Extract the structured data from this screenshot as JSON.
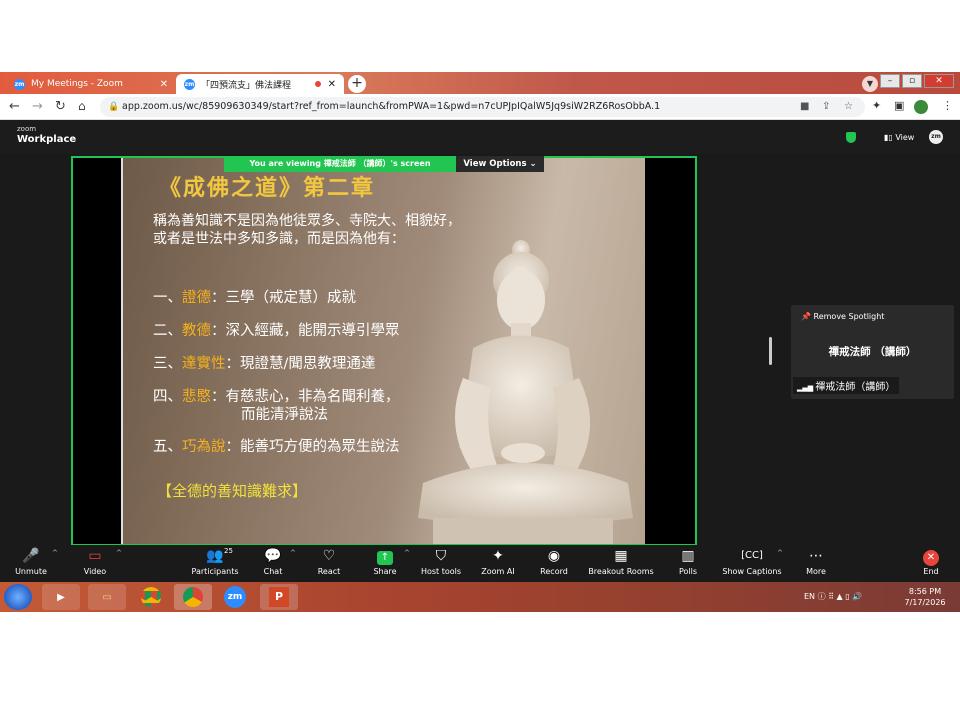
{
  "browser": {
    "tabs": [
      {
        "label": "My Meetings - Zoom",
        "favicon": "zm"
      },
      {
        "label": "「四預流支」佛法課程",
        "favicon": "zm"
      }
    ],
    "new_tab_glyph": "+",
    "window_min": "–",
    "window_max": "▫",
    "window_close": "✕",
    "url": "app.zoom.us/wc/85909630349/start?ref_from=launch&fromPWA=1&pwd=n7cUPJpIQalW5Jq9siW2RZ6RosObbA.1"
  },
  "zoom": {
    "logo_top": "zoom",
    "logo_bottom": "Workplace",
    "view_label": "View",
    "avatar_text": "zm",
    "viewing_banner": "You are viewing  禪戒法師 （講師）'s screen",
    "view_options": "View Options",
    "spotlight_label": "Remove Spotlight",
    "participant_name": "禪戒法師 （講師）",
    "participant_label": "禪戒法師（講師）"
  },
  "slide": {
    "title": "《成佛之道》第二章",
    "intro": "稱為善知識不是因為他徒眾多、寺院大、相貌好，或者是世法中多知多識，而是因為他有：",
    "points": [
      {
        "prefix": "一、",
        "key": "證德",
        "rest": "：三學（戒定慧）成就"
      },
      {
        "prefix": "二、",
        "key": "教德",
        "rest": "：深入經藏，能開示導引學眾"
      },
      {
        "prefix": "三、",
        "key": "達實性",
        "rest": "：現證慧/聞思教理通達"
      },
      {
        "prefix": "四、",
        "key": "悲愍",
        "rest": "：有慈悲心，非為名聞利養，",
        "rest2": "而能清淨說法"
      },
      {
        "prefix": "五、",
        "key": "巧為說",
        "rest": "：能善巧方便的為眾生說法"
      }
    ],
    "footer": "【全德的善知識難求】"
  },
  "toolbar": {
    "unmute": "Unmute",
    "video": "Video",
    "participants": "Participants",
    "participants_count": "25",
    "chat": "Chat",
    "react": "React",
    "share": "Share",
    "host_tools": "Host tools",
    "zoom_ai": "Zoom AI",
    "record": "Record",
    "breakout": "Breakout Rooms",
    "polls": "Polls",
    "captions": "Show Captions",
    "more": "More",
    "end": "End"
  },
  "taskbar": {
    "lang": "EN",
    "time": "8:56 PM",
    "date": "7/17/2026",
    "zoom_app": "zm",
    "ppt_app": "P"
  }
}
